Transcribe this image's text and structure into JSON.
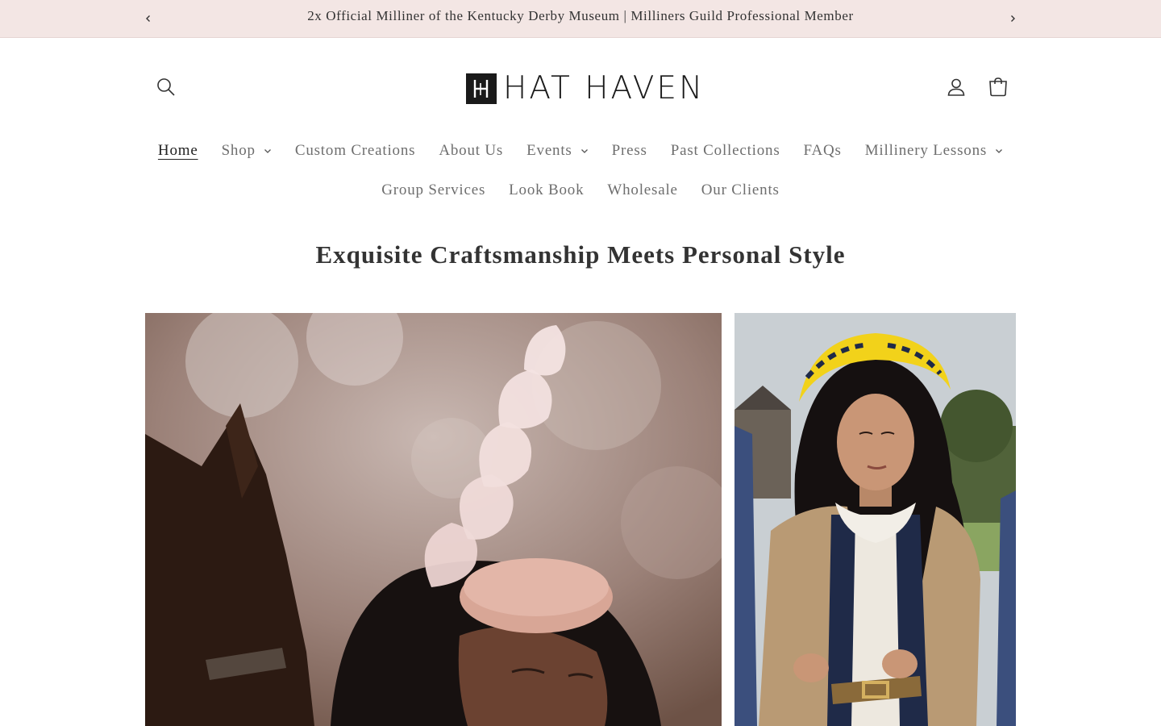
{
  "announcement": {
    "text": "2x Official Milliner of the Kentucky Derby Museum | Milliners Guild Professional Member",
    "prev_icon": "chevron-left-icon",
    "next_icon": "chevron-right-icon"
  },
  "header": {
    "logo_text": "HAT HAVEN",
    "search_icon": "search-icon",
    "account_icon": "account-icon",
    "cart_icon": "cart-icon"
  },
  "nav": {
    "row1": [
      {
        "label": "Home",
        "active": true,
        "dropdown": false
      },
      {
        "label": "Shop",
        "active": false,
        "dropdown": true
      },
      {
        "label": "Custom Creations",
        "active": false,
        "dropdown": false
      },
      {
        "label": "About Us",
        "active": false,
        "dropdown": false
      },
      {
        "label": "Events",
        "active": false,
        "dropdown": true
      },
      {
        "label": "Press",
        "active": false,
        "dropdown": false
      },
      {
        "label": "Past Collections",
        "active": false,
        "dropdown": false
      },
      {
        "label": "FAQs",
        "active": false,
        "dropdown": false
      },
      {
        "label": "Millinery Lessons",
        "active": false,
        "dropdown": true
      }
    ],
    "row2": [
      {
        "label": "Group Services",
        "active": false,
        "dropdown": false
      },
      {
        "label": "Look Book",
        "active": false,
        "dropdown": false
      },
      {
        "label": "Wholesale",
        "active": false,
        "dropdown": false
      },
      {
        "label": "Our Clients",
        "active": false,
        "dropdown": false
      }
    ]
  },
  "hero": {
    "title": "Exquisite Craftsmanship Meets Personal Style"
  },
  "colors": {
    "announcement_bg": "#f3e6e4",
    "nav_text": "#6e6e6e",
    "text_dark": "#333333"
  }
}
